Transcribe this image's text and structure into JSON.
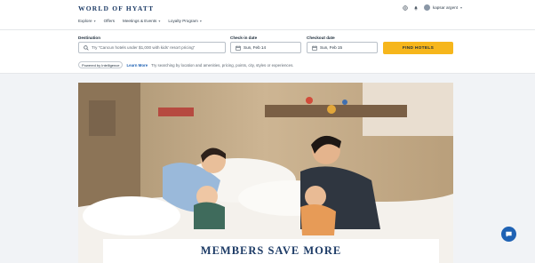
{
  "header": {
    "logo": "WORLD OF HYATT",
    "nav": [
      "Explore",
      "Offers",
      "Meetings & Events",
      "Loyalty Program"
    ],
    "user_name": "kapsar argent"
  },
  "search": {
    "destination_label": "Destination",
    "destination_placeholder": "Try \"Cancun hotels under $1,000 with kids' resort pricing\"",
    "checkin_label": "Check-in date",
    "checkin_value": "Sun, Feb 14",
    "checkout_label": "Checkout date",
    "checkout_value": "Sun, Feb 15",
    "find_button": "FIND HOTELS",
    "ai_chip": "Powered by Intelligence",
    "learn_more": "Learn More",
    "assist_text": "Try searching by location and amenities, pricing, points, city, styles or experiences."
  },
  "hero": {
    "banner_title": "MEMBERS SAVE MORE"
  },
  "colors": {
    "brand": "#1d3b66",
    "cta": "#f6b61c",
    "link": "#1f62b4"
  },
  "icons": [
    "globe-icon",
    "bell-icon",
    "search-icon",
    "calendar-icon",
    "chat-icon"
  ]
}
